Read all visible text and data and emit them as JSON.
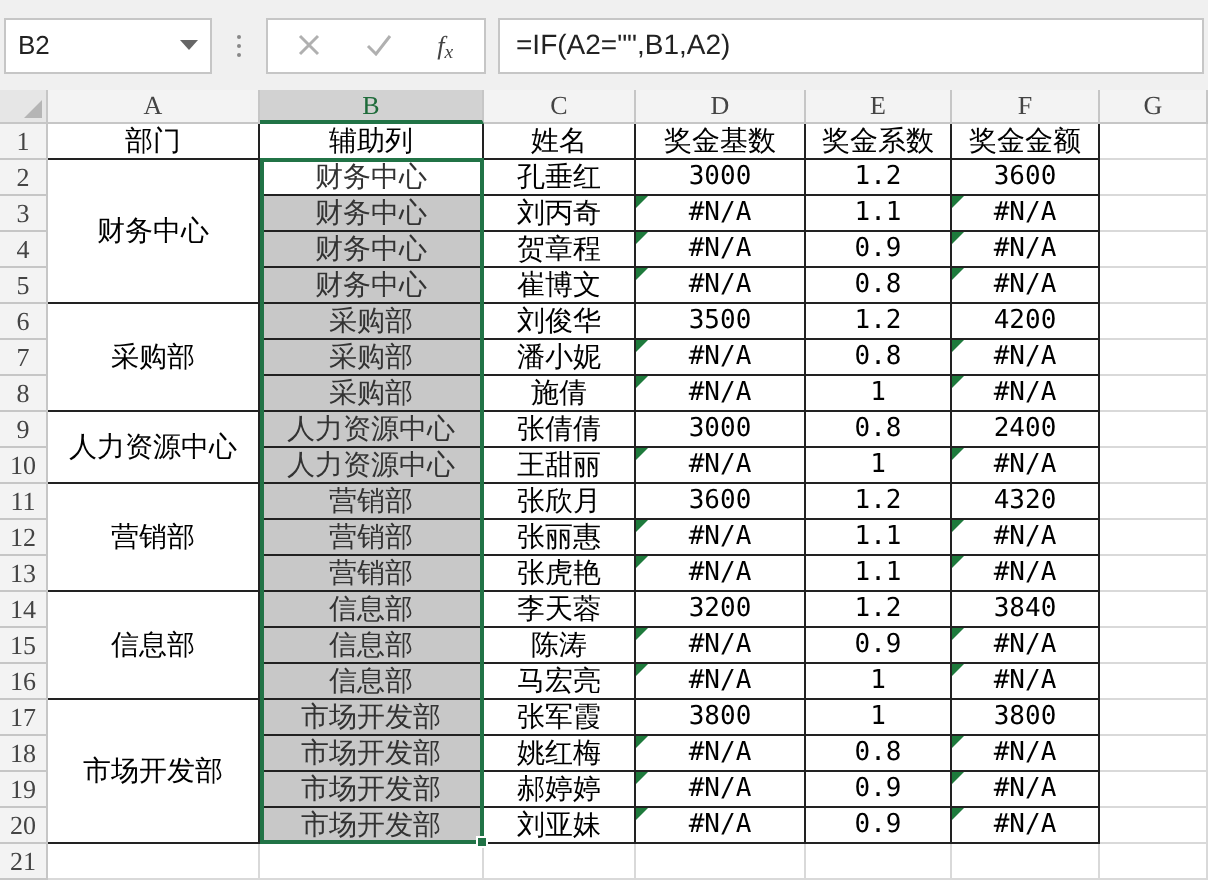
{
  "name_box": {
    "value": "B2"
  },
  "formula_bar": {
    "function_label": "f$_{x}$",
    "formula": "=IF(A2=\"\",B1,A2)"
  },
  "columns": [
    {
      "label": "A",
      "selected": false
    },
    {
      "label": "B",
      "selected": true
    },
    {
      "label": "C",
      "selected": false
    },
    {
      "label": "D",
      "selected": false
    },
    {
      "label": "E",
      "selected": false
    },
    {
      "label": "F",
      "selected": false
    },
    {
      "label": "G",
      "selected": false
    }
  ],
  "row_numbers": [
    "1",
    "2",
    "3",
    "4",
    "5",
    "6",
    "7",
    "8",
    "9",
    "10",
    "11",
    "12",
    "13",
    "14",
    "15",
    "16",
    "17",
    "18",
    "19",
    "20",
    "21"
  ],
  "header": [
    "部门",
    "辅助列",
    "姓名",
    "奖金基数",
    "奖金系数",
    "奖金金额"
  ],
  "groups": [
    {
      "department": "财务中心",
      "rows": [
        {
          "helper": "财务中心",
          "active": true,
          "name": "孔垂红",
          "base": "3000",
          "coef": "1.2",
          "amount": "3600",
          "flagged": false
        },
        {
          "helper": "财务中心",
          "active": false,
          "name": "刘丙奇",
          "base": "#N/A",
          "coef": "1.1",
          "amount": "#N/A",
          "flagged": true
        },
        {
          "helper": "财务中心",
          "active": false,
          "name": "贺章程",
          "base": "#N/A",
          "coef": "0.9",
          "amount": "#N/A",
          "flagged": true
        },
        {
          "helper": "财务中心",
          "active": false,
          "name": "崔博文",
          "base": "#N/A",
          "coef": "0.8",
          "amount": "#N/A",
          "flagged": true
        }
      ]
    },
    {
      "department": "采购部",
      "rows": [
        {
          "helper": "采购部",
          "active": false,
          "name": "刘俊华",
          "base": "3500",
          "coef": "1.2",
          "amount": "4200",
          "flagged": false
        },
        {
          "helper": "采购部",
          "active": false,
          "name": "潘小妮",
          "base": "#N/A",
          "coef": "0.8",
          "amount": "#N/A",
          "flagged": true
        },
        {
          "helper": "采购部",
          "active": false,
          "name": "施倩",
          "base": "#N/A",
          "coef": "1",
          "amount": "#N/A",
          "flagged": true
        }
      ]
    },
    {
      "department": "人力资源中心",
      "rows": [
        {
          "helper": "人力资源中心",
          "active": false,
          "name": "张倩倩",
          "base": "3000",
          "coef": "0.8",
          "amount": "2400",
          "flagged": false
        },
        {
          "helper": "人力资源中心",
          "active": false,
          "name": "王甜丽",
          "base": "#N/A",
          "coef": "1",
          "amount": "#N/A",
          "flagged": true
        }
      ]
    },
    {
      "department": "营销部",
      "rows": [
        {
          "helper": "营销部",
          "active": false,
          "name": "张欣月",
          "base": "3600",
          "coef": "1.2",
          "amount": "4320",
          "flagged": false
        },
        {
          "helper": "营销部",
          "active": false,
          "name": "张丽惠",
          "base": "#N/A",
          "coef": "1.1",
          "amount": "#N/A",
          "flagged": true
        },
        {
          "helper": "营销部",
          "active": false,
          "name": "张虎艳",
          "base": "#N/A",
          "coef": "1.1",
          "amount": "#N/A",
          "flagged": true
        }
      ]
    },
    {
      "department": "信息部",
      "rows": [
        {
          "helper": "信息部",
          "active": false,
          "name": "李天蓉",
          "base": "3200",
          "coef": "1.2",
          "amount": "3840",
          "flagged": false
        },
        {
          "helper": "信息部",
          "active": false,
          "name": "陈涛",
          "base": "#N/A",
          "coef": "0.9",
          "amount": "#N/A",
          "flagged": true
        },
        {
          "helper": "信息部",
          "active": false,
          "name": "马宏亮",
          "base": "#N/A",
          "coef": "1",
          "amount": "#N/A",
          "flagged": true
        }
      ]
    },
    {
      "department": "市场开发部",
      "rows": [
        {
          "helper": "市场开发部",
          "active": false,
          "name": "张军霞",
          "base": "3800",
          "coef": "1",
          "amount": "3800",
          "flagged": false
        },
        {
          "helper": "市场开发部",
          "active": false,
          "name": "姚红梅",
          "base": "#N/A",
          "coef": "0.8",
          "amount": "#N/A",
          "flagged": true
        },
        {
          "helper": "市场开发部",
          "active": false,
          "name": "郝婷婷",
          "base": "#N/A",
          "coef": "0.9",
          "amount": "#N/A",
          "flagged": true
        },
        {
          "helper": "市场开发部",
          "active": false,
          "name": "刘亚妹",
          "base": "#N/A",
          "coef": "0.9",
          "amount": "#N/A",
          "flagged": true
        }
      ]
    }
  ]
}
